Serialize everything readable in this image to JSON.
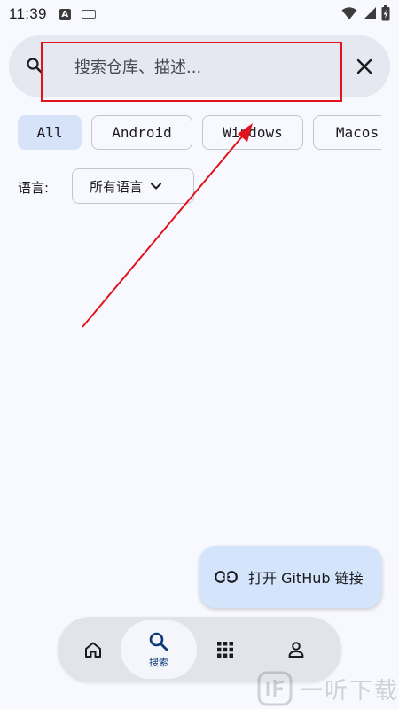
{
  "status_bar": {
    "time": "11:39",
    "notification_icons": [
      "a-icon",
      "keyboard-icon"
    ],
    "system_icons": [
      "wifi-icon",
      "signal-icon",
      "battery-charging-icon"
    ]
  },
  "search": {
    "placeholder": "搜索仓库、描述...",
    "value": ""
  },
  "chips": [
    {
      "label": "All",
      "selected": true
    },
    {
      "label": "Android",
      "selected": false
    },
    {
      "label": "Windows",
      "selected": false
    },
    {
      "label": "Macos",
      "selected": false
    }
  ],
  "language_filter": {
    "label": "语言:",
    "selected": "所有语言"
  },
  "fab": {
    "label": "打开 GitHub 链接"
  },
  "bottom_nav": {
    "items": [
      {
        "icon": "home-icon",
        "label": "",
        "active": false
      },
      {
        "icon": "search-icon",
        "label": "搜索",
        "active": true
      },
      {
        "icon": "grid-icon",
        "label": "",
        "active": false
      },
      {
        "icon": "person-icon",
        "label": "",
        "active": false
      }
    ]
  },
  "watermark": {
    "text": "一听下载"
  },
  "colors": {
    "background": "#f8f9ff",
    "search_bar": "#e5e8f0",
    "chip_selected": "#d6e3f8",
    "fab": "#d3e4fb",
    "nav_bar": "#e2e4ec",
    "nav_active_label": "#0c3b75",
    "annotation": "#e0141e"
  }
}
